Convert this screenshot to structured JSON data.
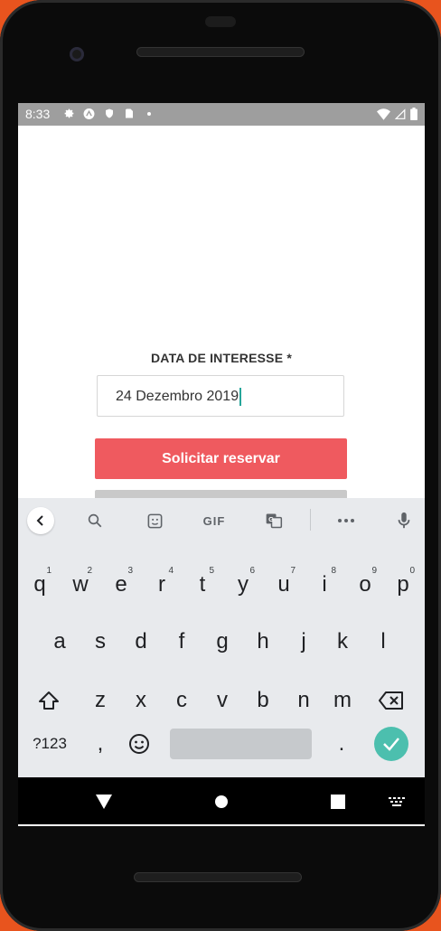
{
  "status_bar": {
    "time": "8:33"
  },
  "form": {
    "field_label": "DATA DE INTERESSE *",
    "date_value": "24 Dezembro 2019",
    "primary_button": "Solicitar reservar"
  },
  "keyboard": {
    "toolbar": {
      "gif_label": "GIF"
    },
    "row1": [
      {
        "key": "q",
        "hint": "1"
      },
      {
        "key": "w",
        "hint": "2"
      },
      {
        "key": "e",
        "hint": "3"
      },
      {
        "key": "r",
        "hint": "4"
      },
      {
        "key": "t",
        "hint": "5"
      },
      {
        "key": "y",
        "hint": "6"
      },
      {
        "key": "u",
        "hint": "7"
      },
      {
        "key": "i",
        "hint": "8"
      },
      {
        "key": "o",
        "hint": "9"
      },
      {
        "key": "p",
        "hint": "0"
      }
    ],
    "row2": [
      "a",
      "s",
      "d",
      "f",
      "g",
      "h",
      "j",
      "k",
      "l"
    ],
    "row3": [
      "z",
      "x",
      "c",
      "v",
      "b",
      "n",
      "m"
    ],
    "row4": {
      "symbols_label": "?123",
      "comma_label": ",",
      "period_label": "."
    }
  },
  "colors": {
    "accent": "#ef5a5f",
    "cursor": "#26a69a",
    "enter_key": "#4cbfae",
    "background": "#e8541e"
  }
}
